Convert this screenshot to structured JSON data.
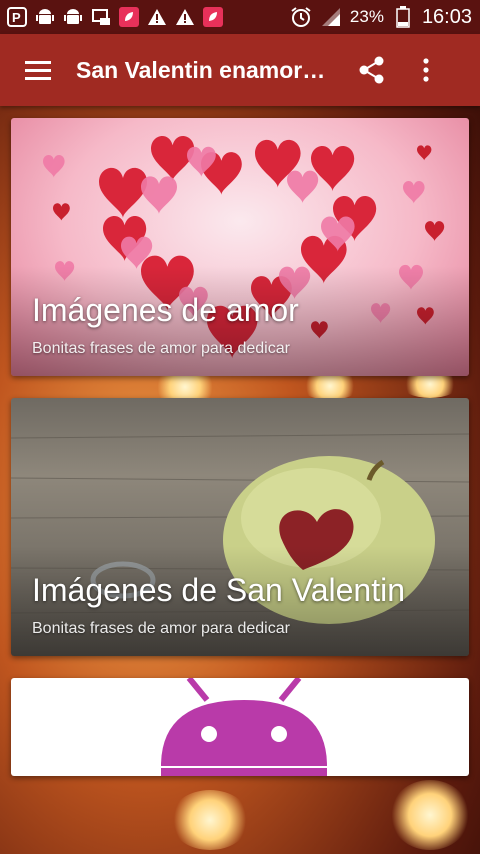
{
  "status_bar": {
    "battery": "23%",
    "time": "16:03",
    "icons": [
      "p-app-icon",
      "android-icon",
      "android-icon",
      "photo-mail-icon",
      "leaf-app-icon",
      "warning-icon",
      "warning-icon",
      "leaf-app-icon",
      "alarm-icon",
      "signal-icon",
      "battery-icon"
    ]
  },
  "app_bar": {
    "title": "San Valentin enamorados",
    "background": "#a02a22",
    "menu_icon": "hamburger-menu-icon",
    "share_icon": "share-icon",
    "more_icon": "overflow-menu-icon"
  },
  "cards": [
    {
      "title": "Imágenes de amor",
      "subtitle": "Bonitas frases de amor para dedicar",
      "image": "heart-of-hearts"
    },
    {
      "title": "Imágenes de San Valentin",
      "subtitle": "Bonitas frases de amor para dedicar",
      "image": "apple-with-heart"
    },
    {
      "image": "android-robot"
    }
  ],
  "colors": {
    "status_bar": "#5a1210",
    "android_purple": "#b93aa9"
  }
}
